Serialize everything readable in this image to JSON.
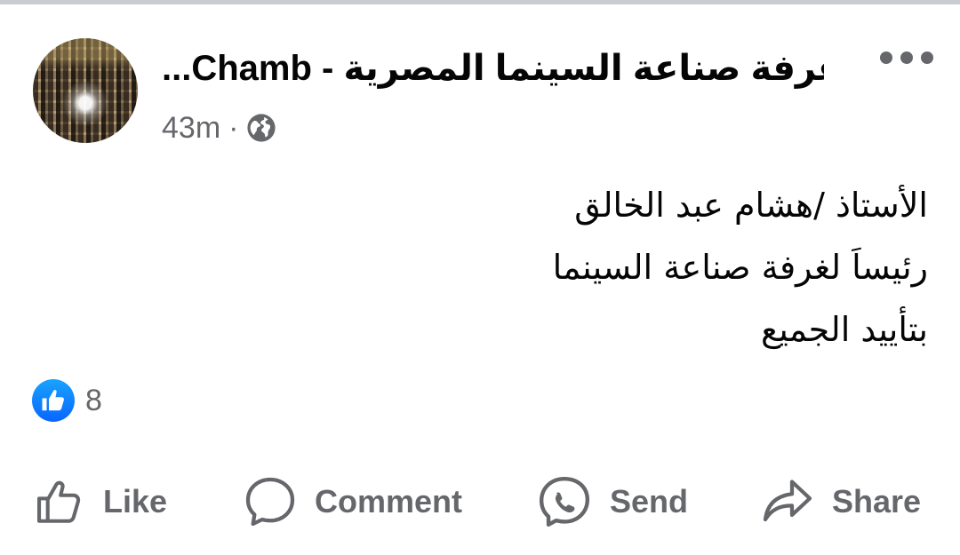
{
  "post": {
    "page_name": "غرفة صناعة السينما المصرية - Chamb...",
    "time": "43m",
    "separator": "·",
    "privacy_icon": "globe-icon",
    "more_icon": "more-horizontal-icon",
    "body_lines": [
      "الأستاذ /هشام عبد الخالق",
      "رئيساَ لغرفة صناعة السينما",
      "بتأييد الجميع"
    ],
    "reactions": {
      "icon": "like-reaction-icon",
      "count": "8",
      "color": "#0866FF"
    }
  },
  "actions": {
    "like": {
      "label": "Like",
      "icon": "thumbs-up-icon"
    },
    "comment": {
      "label": "Comment",
      "icon": "comment-bubble-icon"
    },
    "send": {
      "label": "Send",
      "icon": "messenger-icon"
    },
    "share": {
      "label": "Share",
      "icon": "share-arrow-icon"
    }
  },
  "colors": {
    "secondary_text": "#65676B",
    "primary_text": "#050505",
    "accent": "#0866FF"
  }
}
